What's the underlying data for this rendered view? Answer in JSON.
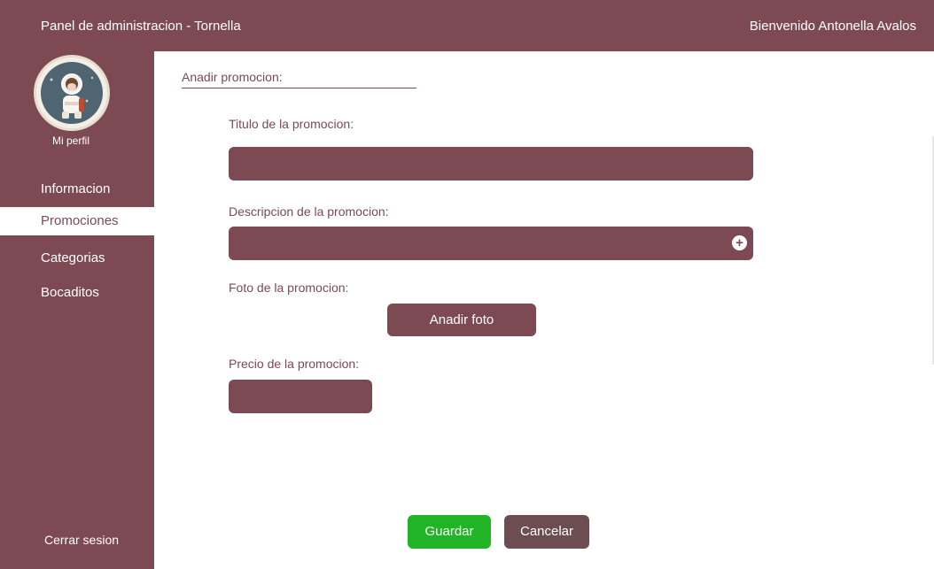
{
  "header": {
    "title": "Panel de administracion - Tornella",
    "welcome": "Bienvenido Antonella Avalos"
  },
  "sidebar": {
    "profile_label": "Mi perfil",
    "items": [
      {
        "label": "Informacion"
      },
      {
        "label": "Promociones"
      },
      {
        "label": "Categorias"
      },
      {
        "label": "Bocaditos"
      }
    ],
    "logout": "Cerrar sesion"
  },
  "form": {
    "section_title": "Anadir promocion:",
    "title_label": "Titulo de la promocion:",
    "description_label": "Descripcion de la promocion:",
    "photo_label": "Foto de la promocion:",
    "photo_button": "Anadir foto",
    "price_label": "Precio de la promocion:",
    "save_button": "Guardar",
    "cancel_button": "Cancelar"
  },
  "colors": {
    "primary": "#7d4a53",
    "save": "#22b427",
    "cancel": "#6c4d52"
  }
}
